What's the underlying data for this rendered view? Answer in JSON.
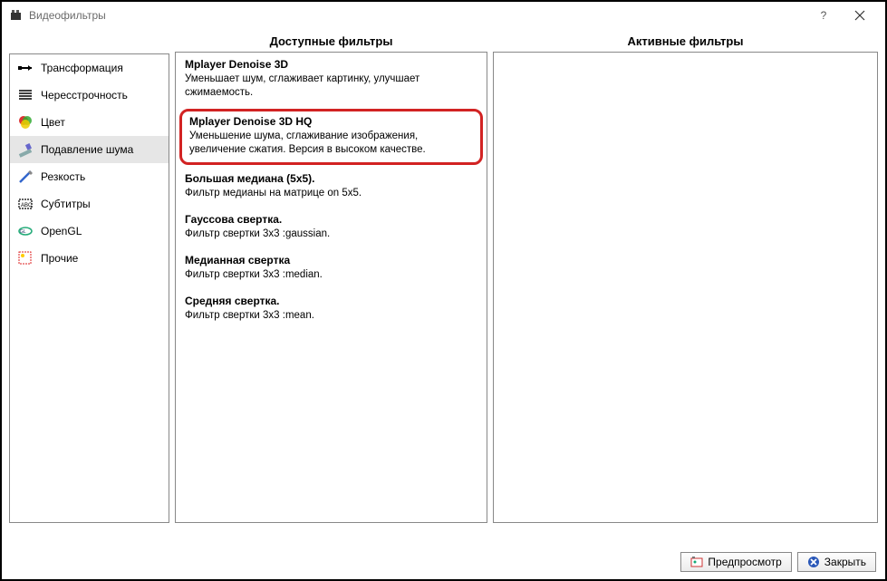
{
  "window": {
    "title": "Видеофильтры"
  },
  "headers": {
    "available": "Доступные фильтры",
    "active": "Активные фильтры"
  },
  "sidebar": {
    "items": [
      {
        "label": "Трансформация"
      },
      {
        "label": "Чересстрочность"
      },
      {
        "label": "Цвет"
      },
      {
        "label": "Подавление шума"
      },
      {
        "label": "Резкость"
      },
      {
        "label": "Субтитры"
      },
      {
        "label": "OpenGL"
      },
      {
        "label": "Прочие"
      }
    ],
    "selectedIndex": 3
  },
  "filters": [
    {
      "title": "Mplayer Denoise 3D",
      "desc": "Уменьшает шум, сглаживает картинку, улучшает сжимаемость."
    },
    {
      "title": "Mplayer Denoise 3D HQ",
      "desc": "Уменьшение шума, сглаживание изображения, увеличение сжатия. Версия в высоком качестве.",
      "highlighted": true
    },
    {
      "title": "Большая медиана (5x5).",
      "desc": "Фильтр медианы на матрице on 5x5."
    },
    {
      "title": "Гауссова свертка.",
      "desc": "Фильтр свертки 3x3 :gaussian."
    },
    {
      "title": "Медианная свертка",
      "desc": "Фильтр свертки 3x3 :median."
    },
    {
      "title": "Средняя свертка.",
      "desc": "Фильтр свертки 3x3 :mean."
    }
  ],
  "buttons": {
    "preview": "Предпросмотр",
    "close": "Закрыть"
  }
}
